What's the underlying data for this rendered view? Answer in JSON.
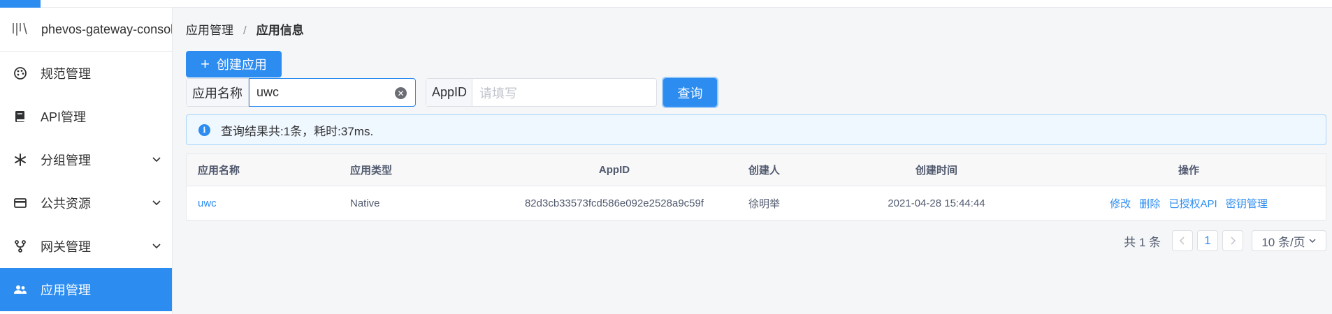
{
  "app": {
    "title": "phevos-gateway-console"
  },
  "sidebar": {
    "items": [
      {
        "label": "规范管理",
        "icon": "palette-icon",
        "expandable": false,
        "active": false
      },
      {
        "label": "API管理",
        "icon": "book-icon",
        "expandable": false,
        "active": false
      },
      {
        "label": "分组管理",
        "icon": "snowflake-icon",
        "expandable": true,
        "active": false
      },
      {
        "label": "公共资源",
        "icon": "card-icon",
        "expandable": true,
        "active": false
      },
      {
        "label": "网关管理",
        "icon": "fork-icon",
        "expandable": true,
        "active": false
      },
      {
        "label": "应用管理",
        "icon": "people-icon",
        "expandable": false,
        "active": true
      }
    ]
  },
  "breadcrumb": {
    "parent": "应用管理",
    "separator": "/",
    "current": "应用信息"
  },
  "toolbar": {
    "create_label": "创建应用",
    "create_icon": "plus-icon"
  },
  "filters": {
    "app_name": {
      "label": "应用名称",
      "value": "uwc"
    },
    "app_id": {
      "label": "AppID",
      "value": "",
      "placeholder": "请填写"
    },
    "query_label": "查询"
  },
  "alert": {
    "text": "查询结果共:1条，耗时:37ms."
  },
  "table": {
    "headers": [
      "应用名称",
      "应用类型",
      "AppID",
      "创建人",
      "创建时间",
      "操作"
    ],
    "rows": [
      {
        "name": "uwc",
        "type": "Native",
        "appid": "82d3cb33573fcd586e092e2528a9c59f",
        "creator": "徐明举",
        "created_at": "2021-04-28 15:44:44",
        "actions": [
          "修改",
          "删除",
          "已授权API",
          "密钥管理"
        ]
      }
    ]
  },
  "pagination": {
    "total": "共 1 条",
    "current": "1",
    "page_size": "10 条/页"
  },
  "colors": {
    "accent": "#2d8cf0",
    "alert_bg": "#f0f8ff",
    "sidebar_active": "#2d8cf0"
  }
}
